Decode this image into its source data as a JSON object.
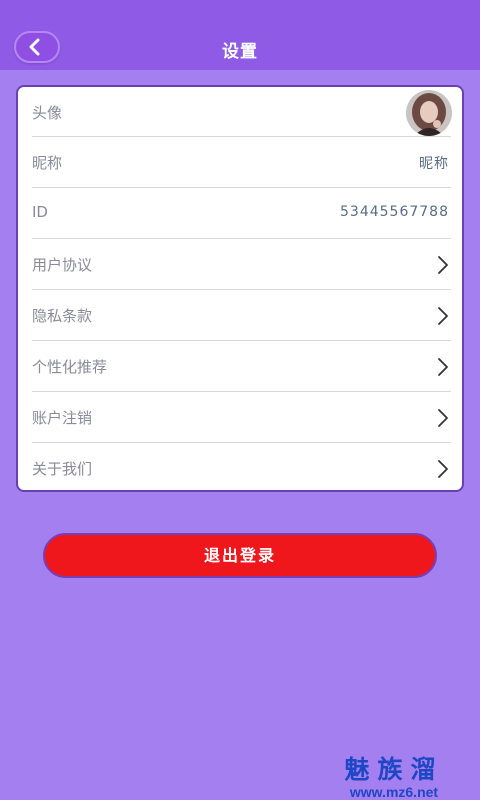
{
  "header": {
    "title": "设置",
    "back_icon": "chevron-left-icon",
    "background": "#8f5ae6"
  },
  "settings": {
    "avatar": {
      "label": "头像"
    },
    "nickname": {
      "label": "昵称",
      "value": "昵称"
    },
    "id": {
      "label": "ID",
      "value": "53445567788"
    },
    "items": [
      {
        "label": "用户协议",
        "icon": "chevron-right-icon"
      },
      {
        "label": "隐私条款",
        "icon": "chevron-right-icon"
      },
      {
        "label": "个性化推荐",
        "icon": "chevron-right-icon"
      },
      {
        "label": "账户注销",
        "icon": "chevron-right-icon"
      },
      {
        "label": "关于我们",
        "icon": "chevron-right-icon"
      }
    ]
  },
  "logout": {
    "label": "退出登录",
    "color": "#f0171c"
  },
  "watermark": {
    "line1": "魅族溜",
    "line2": "www.mz6.net"
  },
  "colors": {
    "background": "#a47ff0",
    "accent": "#8f5ae6"
  }
}
